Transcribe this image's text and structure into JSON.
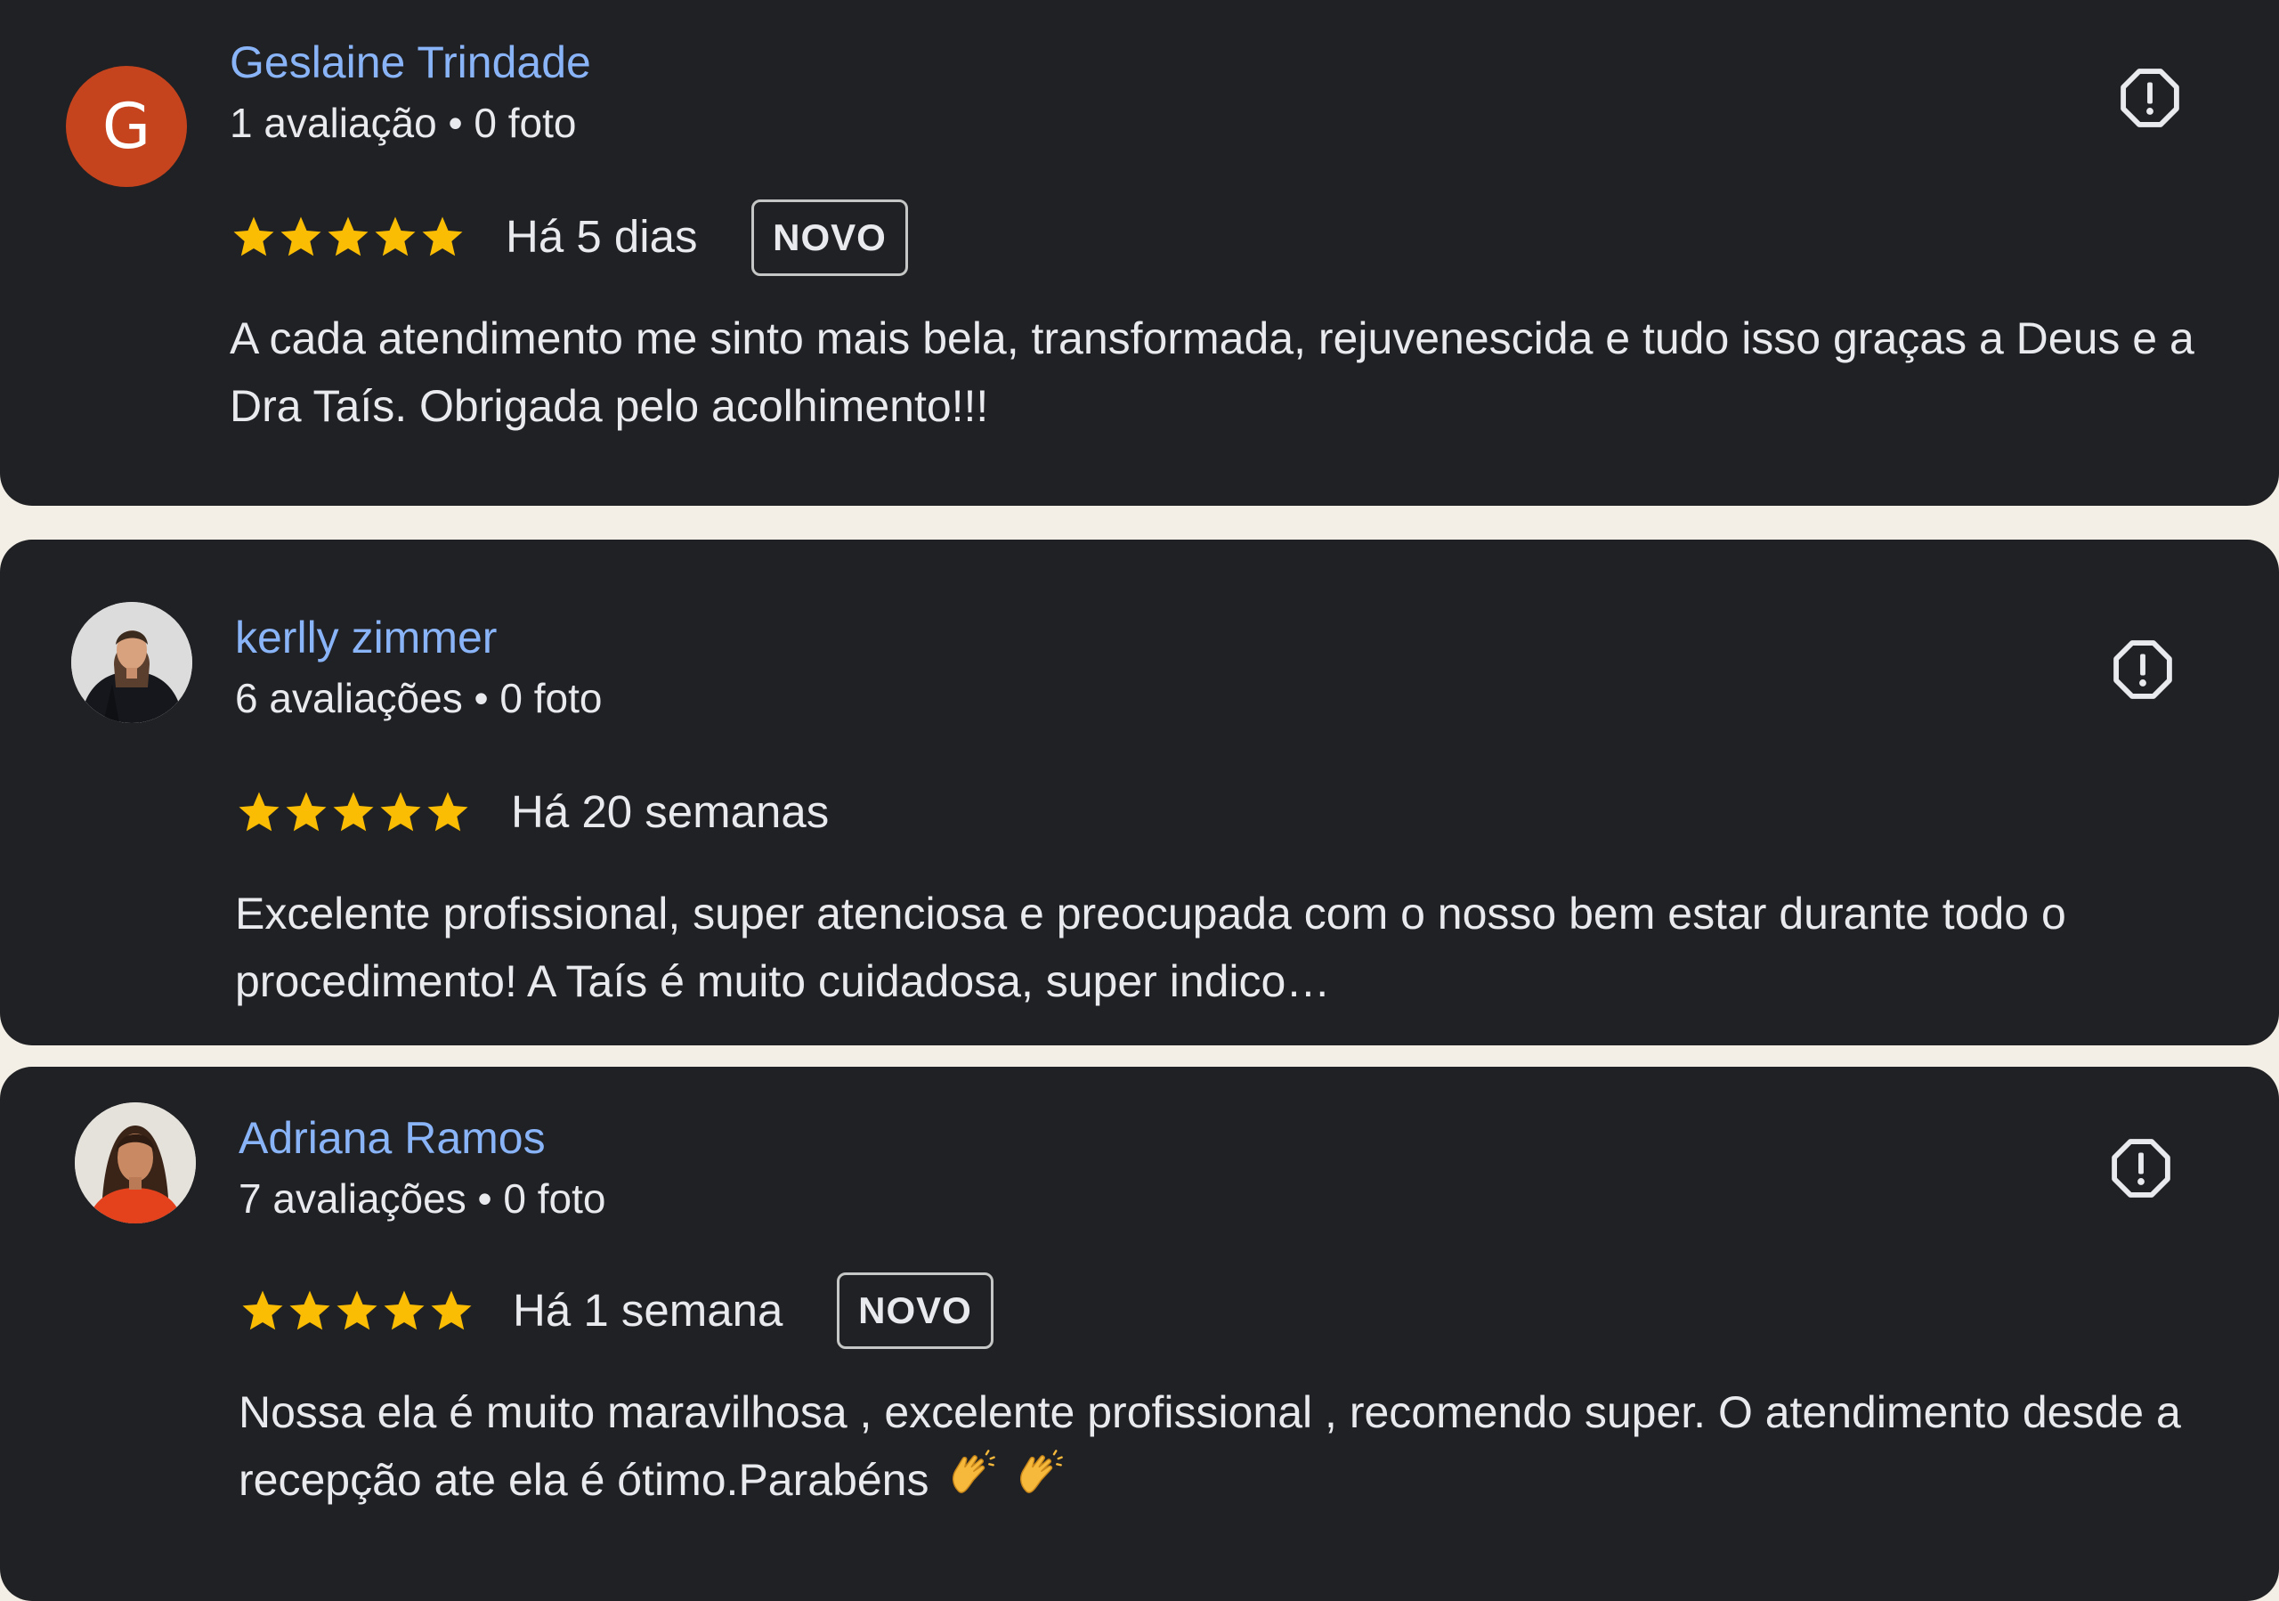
{
  "reviews": [
    {
      "avatar_letter": "G",
      "avatar_color": "#c5441e",
      "name": "Geslaine Trindade",
      "meta": "1 avaliação • 0 foto",
      "rating": 5,
      "date": "Há 5 dias",
      "badge": "NOVO",
      "text": "A cada atendimento me sinto mais bela, transformada, rejuvenescida e tudo isso graças a Deus e a Dra Taís. Obrigada pelo acolhimento!!!"
    },
    {
      "avatar_letter": "",
      "name": "kerlly zimmer",
      "meta": "6 avaliações • 0 foto",
      "rating": 5,
      "date": "Há 20 semanas",
      "badge": "",
      "text": "Excelente profissional, super atenciosa e preocupada com o nosso bem estar durante todo o procedimento! A Taís é muito cuidadosa, super indico…"
    },
    {
      "avatar_letter": "",
      "name": "Adriana Ramos",
      "meta": "7 avaliações • 0 foto",
      "rating": 5,
      "date": "Há 1 semana",
      "badge": "NOVO",
      "text": "Nossa ela é muito maravilhosa , excelente profissional , recomendo super. O atendimento desde a recepção ate ela é ótimo.Parabéns",
      "emoji": [
        "clapping-hands-emoji",
        "clapping-hands-emoji"
      ]
    }
  ],
  "colors": {
    "card_bg": "#202124",
    "name": "#8ab4f8",
    "text": "#e8eaed",
    "star": "#fbbc04",
    "page_bg": "#f3efe6"
  },
  "icons": {
    "star": "star-icon",
    "report": "report-flag-icon"
  }
}
